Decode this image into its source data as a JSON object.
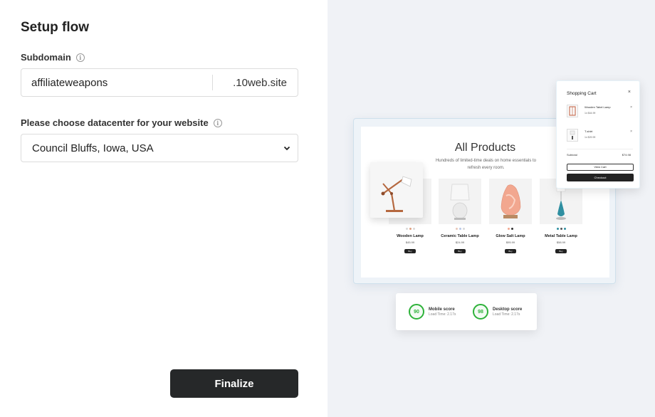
{
  "setup": {
    "title": "Setup flow",
    "subdomain_label": "Subdomain",
    "subdomain_value": "affiliateweapons",
    "subdomain_suffix": ".10web.site",
    "datacenter_label": "Please choose datacenter for your website",
    "datacenter_value": "Council Bluffs, Iowa, USA",
    "finalize_label": "Finalize"
  },
  "preview": {
    "products_title": "All Products",
    "products_subtitle": "Hundreds of limited-time deals on home essentials to refresh every room.",
    "products": [
      {
        "name": "Wooden Lamp",
        "price": "$45.99",
        "buy": "Buy"
      },
      {
        "name": "Ceramic Table Lamp",
        "price": "$24.99",
        "buy": "Buy"
      },
      {
        "name": "Glow Salt Lamp",
        "price": "$95.99",
        "buy": "Buy"
      },
      {
        "name": "Metal Table Lamp",
        "price": "$58.99",
        "buy": "Buy"
      }
    ],
    "cart": {
      "title": "Shopping Cart",
      "close": "×",
      "items": [
        {
          "name": "Wooden Tabel Lamp",
          "price": "1x $44.99",
          "remove": "×"
        },
        {
          "name": "T-shirt",
          "price": "1x $29.99",
          "remove": "×"
        }
      ],
      "subtotal_label": "Subtotal",
      "subtotal_value": "$74.98",
      "view_cart": "View Cart",
      "checkout": "Checkout"
    },
    "scores": [
      {
        "value": "90",
        "label": "Mobile score",
        "load": "Load Time: 2.17s"
      },
      {
        "value": "98",
        "label": "Desktop score",
        "load": "Load Time: 2.17s"
      }
    ]
  },
  "colors": {
    "button_dark": "#262829",
    "right_panel_bg": "#f0f2f6",
    "score_green": "#2eb23a"
  }
}
